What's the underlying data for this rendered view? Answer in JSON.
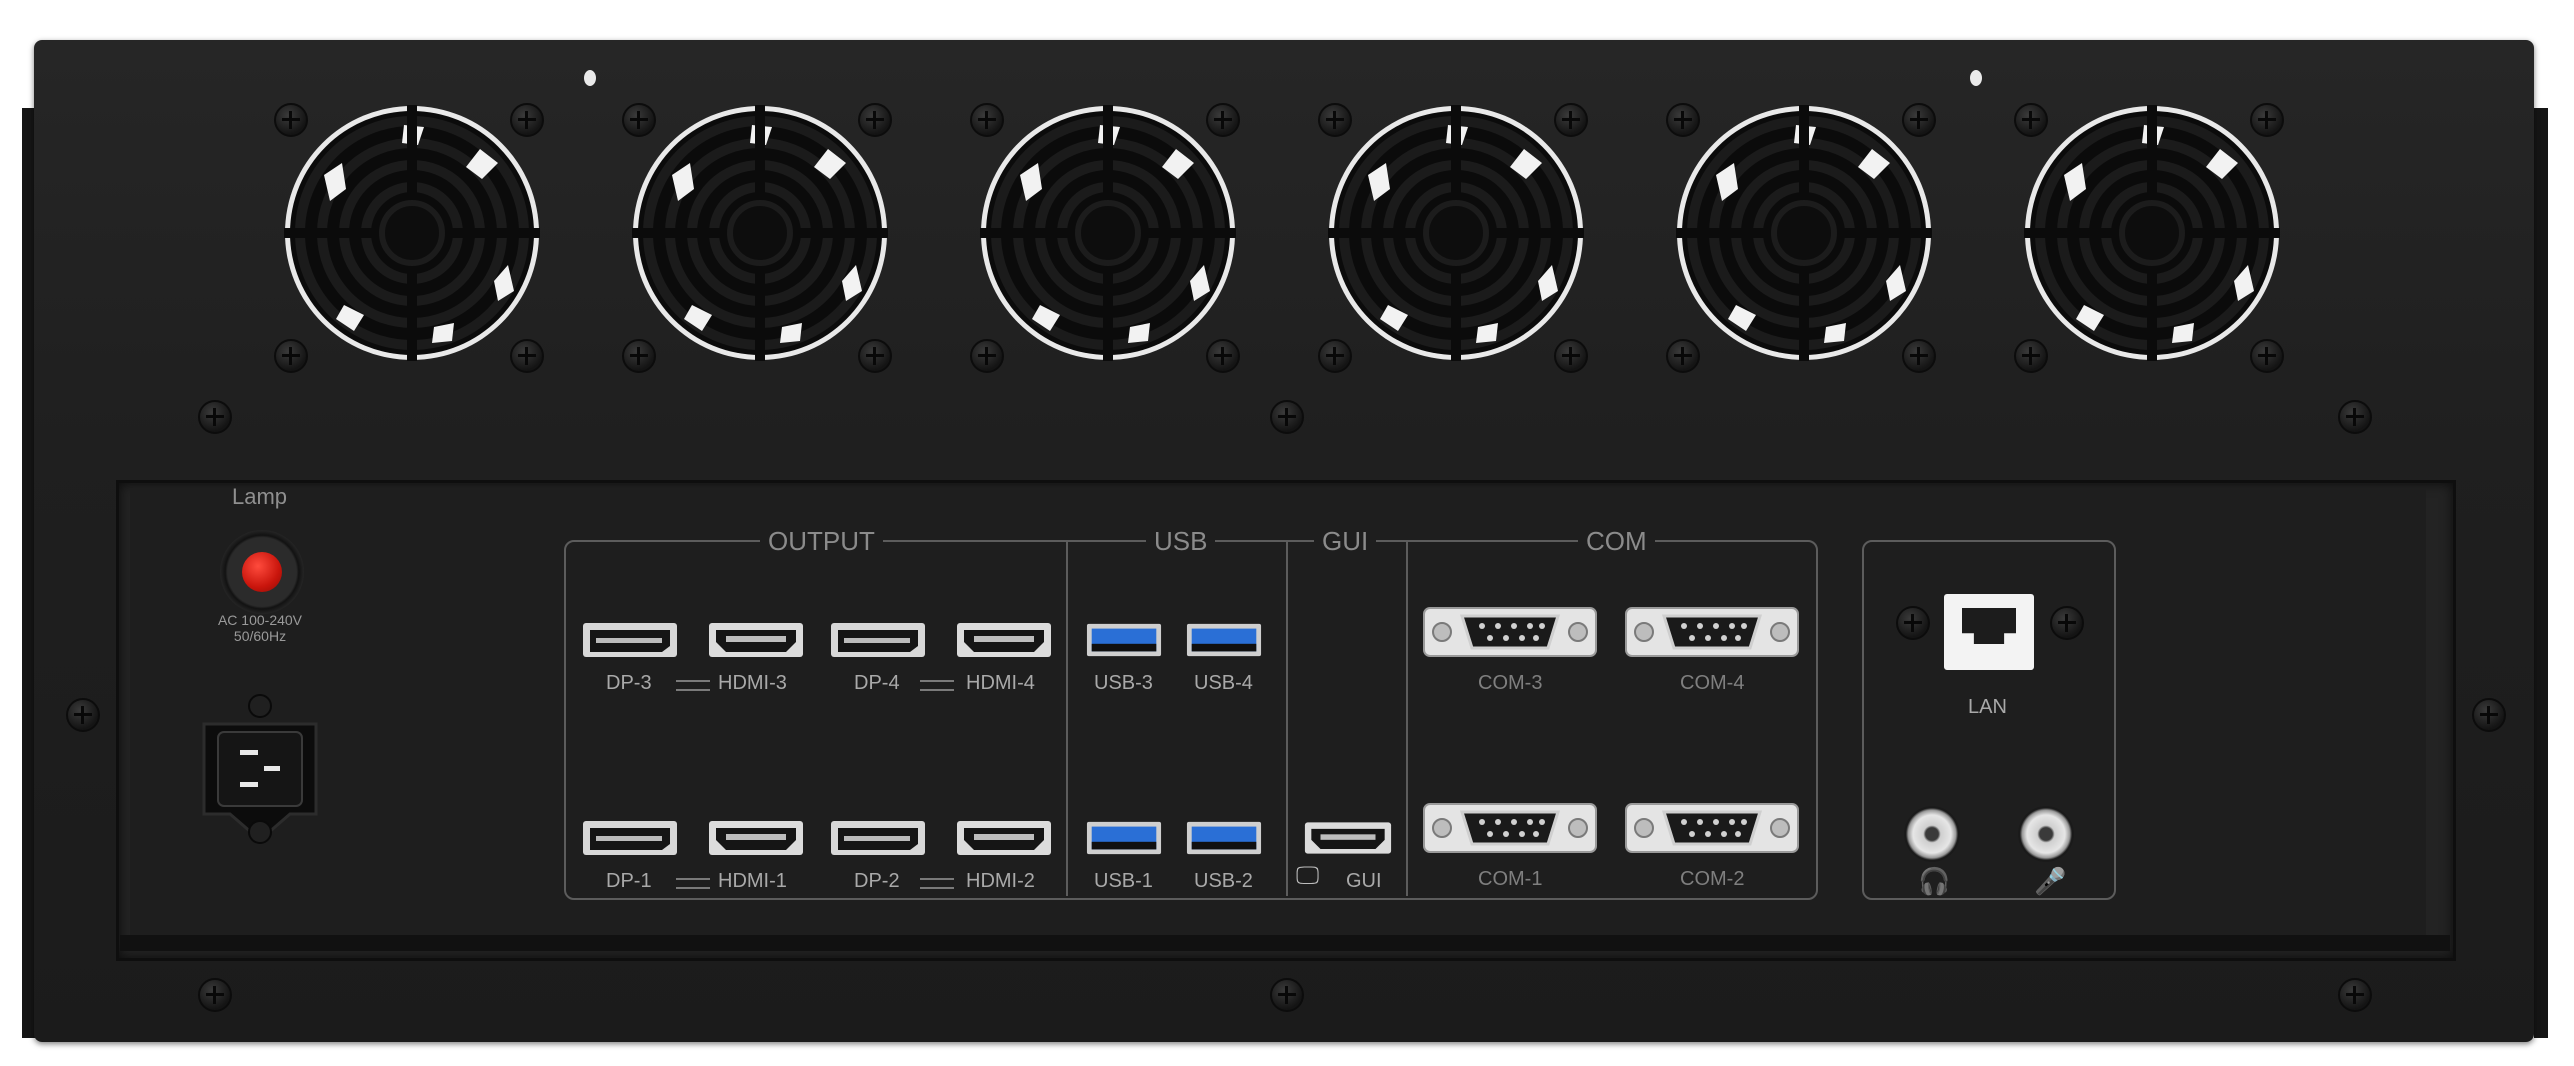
{
  "panel": {
    "lamp_label": "Lamp",
    "ac_line1": "AC 100-240V",
    "ac_line2": "50/60Hz"
  },
  "groups": {
    "output": "OUTPUT",
    "usb": "USB",
    "gui": "GUI",
    "com": "COM"
  },
  "ports": {
    "dp3": "DP-3",
    "hdmi3": "HDMI-3",
    "dp4": "DP-4",
    "hdmi4": "HDMI-4",
    "dp1": "DP-1",
    "hdmi1": "HDMI-1",
    "dp2": "DP-2",
    "hdmi2": "HDMI-2",
    "usb3": "USB-3",
    "usb4": "USB-4",
    "usb1": "USB-1",
    "usb2": "USB-2",
    "gui": "GUI",
    "com3": "COM-3",
    "com4": "COM-4",
    "com1": "COM-1",
    "com2": "COM-2",
    "lan": "LAN"
  },
  "icons": [
    "fan-icon",
    "power-button-icon",
    "iec-power-inlet-icon",
    "displayport-icon",
    "hdmi-icon",
    "usb-icon",
    "db9-serial-icon",
    "rj45-icon",
    "headphone-icon",
    "microphone-icon",
    "monitor-icon"
  ],
  "colors": {
    "chassis": "#1f1f1f",
    "lamp": "#d0180e",
    "usb_blue": "#2a6fd6",
    "label": "#a9a9a9"
  }
}
